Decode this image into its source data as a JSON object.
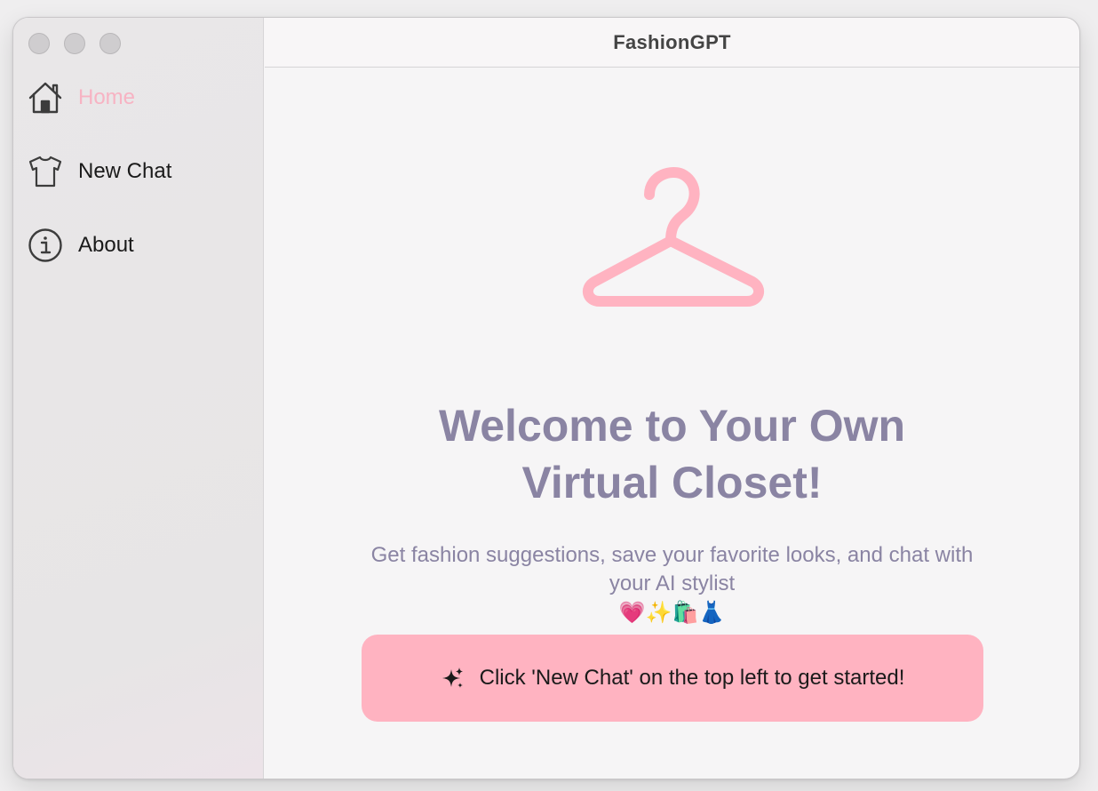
{
  "app": {
    "title": "FashionGPT"
  },
  "sidebar": {
    "items": [
      {
        "label": "Home",
        "icon": "house-icon",
        "active": true
      },
      {
        "label": "New Chat",
        "icon": "tshirt-icon",
        "active": false
      },
      {
        "label": "About",
        "icon": "info-icon",
        "active": false
      }
    ]
  },
  "main": {
    "icon": "hanger-icon",
    "headline_line1": "Welcome to Your Own",
    "headline_line2": "Virtual Closet!",
    "subtext_line1": "Get fashion suggestions, save your favorite looks, and chat with",
    "subtext_line2": "your AI stylist",
    "subtext_emojis": "💗✨🛍️👗",
    "cta_label": "Click 'New Chat' on the top left to get started!",
    "cta_icon": "sparkle-icon"
  },
  "colors": {
    "accent_pink": "#ffb3c1",
    "headline": "#8a84a3",
    "active_nav": "#f7b3c3"
  }
}
